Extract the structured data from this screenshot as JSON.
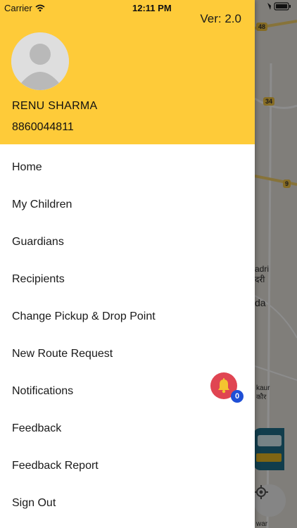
{
  "status_bar": {
    "carrier": "Carrier",
    "time": "12:11 PM"
  },
  "app_version": "Ver: 2.0",
  "user": {
    "name": "RENU SHARMA",
    "phone": "8860044811"
  },
  "menu": {
    "items": [
      {
        "label": "Home"
      },
      {
        "label": "My Children"
      },
      {
        "label": "Guardians"
      },
      {
        "label": "Recipients"
      },
      {
        "label": "Change Pickup & Drop Point"
      },
      {
        "label": "New Route Request"
      },
      {
        "label": "Notifications"
      },
      {
        "label": "Feedback"
      },
      {
        "label": "Feedback Report"
      },
      {
        "label": "Sign Out"
      }
    ]
  },
  "notifications": {
    "count": "0",
    "icon": "bell-icon",
    "color": "#e04552",
    "badge_color": "#1f4fd6"
  },
  "map": {
    "labels": {
      "road_48": "48",
      "road_34": "34",
      "road_9": "9",
      "place_1a": "adri",
      "place_1b": "दरी",
      "place_2": "da",
      "place_3a": "kaur",
      "place_3b": "कौर",
      "place_4": "war"
    }
  },
  "colors": {
    "header": "#fecb39",
    "drawer_bg": "#ffffff",
    "text": "#1a1a1a"
  }
}
